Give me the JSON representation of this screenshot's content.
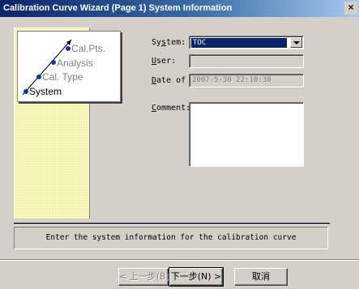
{
  "window": {
    "title": "Calibration Curve Wizard (Page 1) System Information",
    "close_glyph": "×"
  },
  "steps": {
    "items": [
      "Cal.Pts.",
      "Analysis",
      "Cal. Type",
      "System"
    ],
    "active": "System"
  },
  "form": {
    "system": {
      "label": "System:",
      "value": "TOC"
    },
    "user": {
      "label": "User:",
      "value": ""
    },
    "date": {
      "label": "Date of",
      "value": "2007-5-30 22:10:38"
    },
    "comment": {
      "label": "Comment:",
      "value": ""
    }
  },
  "info_text": "Enter the system information for the calibration curve",
  "buttons": {
    "back": "< 上一步(B)",
    "next": "下一步(N) >",
    "cancel": "取消"
  },
  "colors": {
    "side_panel": "#ffffc0",
    "selection": "#0a246a",
    "step_dot": "#1f2f9f"
  }
}
